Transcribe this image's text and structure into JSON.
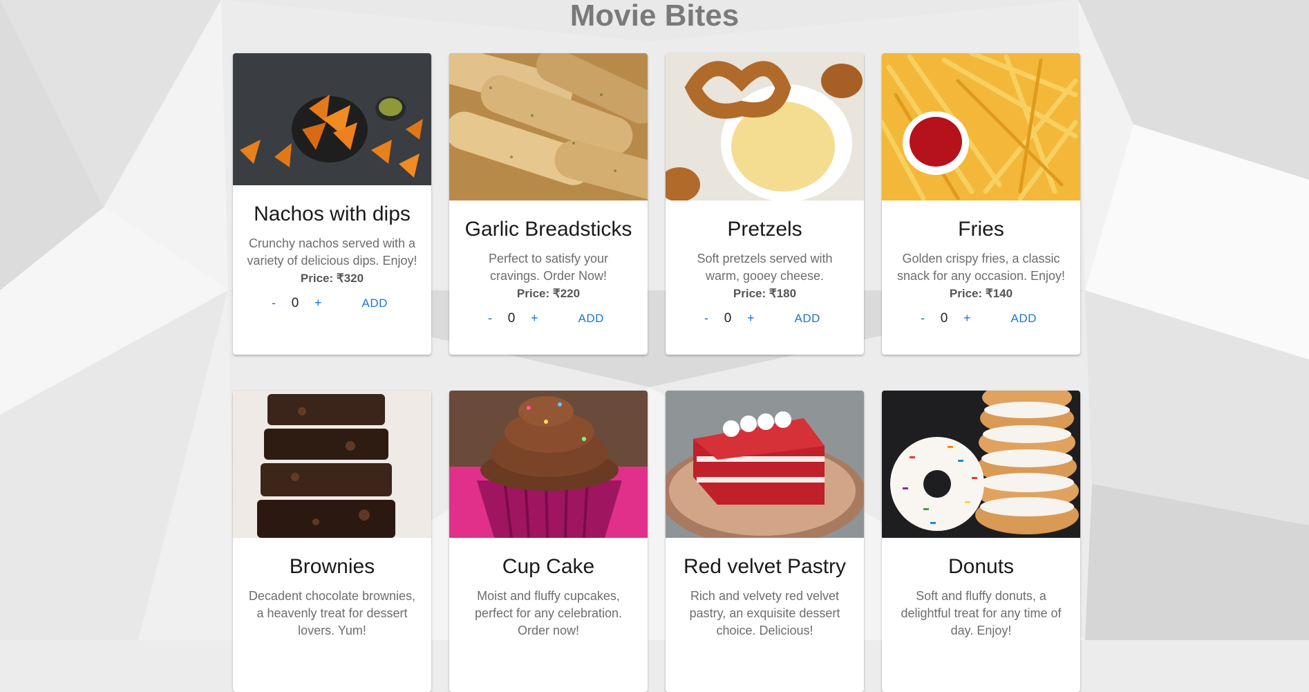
{
  "page": {
    "title": "Movie Bites"
  },
  "items": [
    {
      "name": "Nachos with dips",
      "description": "Crunchy nachos served with a variety of delicious dips. Enjoy!",
      "price": "Price: ₹320",
      "quantity": "0",
      "minus": "-",
      "plus": "+",
      "add": "ADD",
      "image_icon": "nachos-image"
    },
    {
      "name": "Garlic Breadsticks",
      "description": "Perfect to satisfy your cravings. Order Now!",
      "price": "Price: ₹220",
      "quantity": "0",
      "minus": "-",
      "plus": "+",
      "add": "ADD",
      "image_icon": "breadsticks-image"
    },
    {
      "name": "Pretzels",
      "description": "Soft pretzels served with warm, gooey cheese.",
      "price": "Price: ₹180",
      "quantity": "0",
      "minus": "-",
      "plus": "+",
      "add": "ADD",
      "image_icon": "pretzel-image"
    },
    {
      "name": "Fries",
      "description": "Golden crispy fries, a classic snack for any occasion. Enjoy!",
      "price": "Price: ₹140",
      "quantity": "0",
      "minus": "-",
      "plus": "+",
      "add": "ADD",
      "image_icon": "fries-image"
    },
    {
      "name": "Brownies",
      "description": "Decadent chocolate brownies, a heavenly treat for dessert lovers. Yum!",
      "image_icon": "brownies-image"
    },
    {
      "name": "Cup Cake",
      "description": "Moist and fluffy cupcakes, perfect for any celebration. Order now!",
      "image_icon": "cupcake-image"
    },
    {
      "name": "Red velvet Pastry",
      "description": "Rich and velvety red velvet pastry, an exquisite dessert choice. Delicious!",
      "image_icon": "pastry-image"
    },
    {
      "name": "Donuts",
      "description": "Soft and fluffy donuts, a delightful treat for any time of day. Enjoy!",
      "image_icon": "donuts-image"
    }
  ],
  "colors": {
    "accent": "#1976d2",
    "title": "#7a7a7a",
    "background": "#ececec"
  }
}
